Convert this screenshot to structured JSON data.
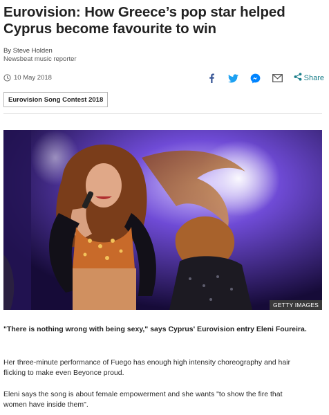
{
  "article": {
    "headline": "Eurovision: How Greece’s pop star helped Cyprus become favourite to win",
    "byline_name": "By Steve Holden",
    "byline_role": "Newsbeat music reporter",
    "date": "10 May 2018",
    "share_label": "Share",
    "tag": "Eurovision Song Contest 2018",
    "image_credit": "GETTY IMAGES",
    "lead": "\"There is nothing wrong with being sexy,\" says Cyprus' Eurovision entry Eleni Foureira.",
    "paragraphs": [
      "Her three-minute performance of Fuego has enough high intensity choreography and hair flicking to make even Beyonce proud.",
      "Eleni says the song is about female empowerment and she wants \"to show the fire that women have inside them\"."
    ]
  },
  "share_icons": [
    "facebook-icon",
    "twitter-icon",
    "messenger-icon",
    "email-icon",
    "share-icon"
  ],
  "colors": {
    "facebook": "#3b5998",
    "twitter": "#1da1f2",
    "messenger": "#0084ff",
    "email": "#555555",
    "share_accent": "#1a7e8a",
    "credit_bg": "#3a3a3a"
  }
}
